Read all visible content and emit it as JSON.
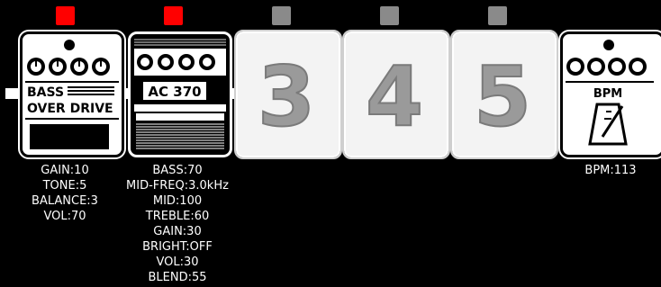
{
  "leds": [
    {
      "color": "#ff0000",
      "state": "on"
    },
    {
      "color": "#ff0000",
      "state": "on"
    },
    {
      "color": "#8a8a8a",
      "state": "off"
    },
    {
      "color": "#8a8a8a",
      "state": "off"
    },
    {
      "color": "#8a8a8a",
      "state": "off"
    }
  ],
  "slots": [
    {
      "type": "effect",
      "icon": "bass-overdrive-pedal-icon",
      "label_line1": "BASS",
      "label_line2": "OVER DRIVE",
      "params": [
        "GAIN:10",
        "TONE:5",
        "BALANCE:3",
        "VOL:70"
      ]
    },
    {
      "type": "effect",
      "icon": "amp-pedal-icon",
      "label": "AC 370",
      "params": [
        "BASS:70",
        "MID-FREQ:3.0kHz",
        "MID:100",
        "TREBLE:60",
        "GAIN:30",
        "BRIGHT:OFF",
        "VOL:30",
        "BLEND:55"
      ]
    },
    {
      "type": "empty",
      "number": "3"
    },
    {
      "type": "empty",
      "number": "4"
    },
    {
      "type": "empty",
      "number": "5"
    },
    {
      "type": "utility",
      "icon": "metronome-icon",
      "label": "BPM",
      "params": [
        "BPM:113"
      ]
    }
  ],
  "colors": {
    "background": "#000000",
    "chain": "#ffffff",
    "led_on": "#ff0000",
    "led_off": "#8a8a8a",
    "empty_number": "#9a9a9a"
  }
}
